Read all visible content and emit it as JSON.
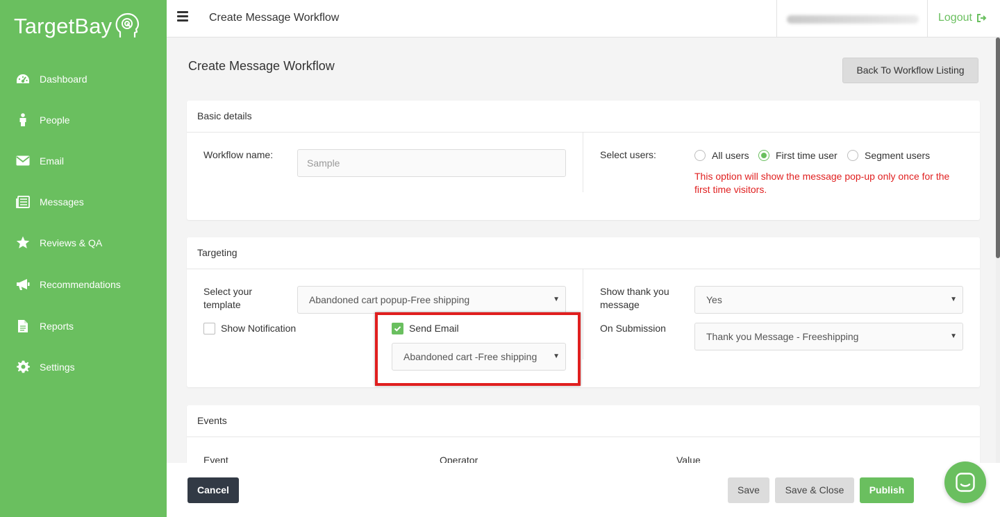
{
  "brand": {
    "name": "TargetBay"
  },
  "colors": {
    "primary": "#6abf5f",
    "warning_text": "#e01f1f",
    "dark": "#323a45"
  },
  "sidebar": {
    "items": [
      {
        "label": "Dashboard",
        "icon": "dashboard-icon"
      },
      {
        "label": "People",
        "icon": "person-icon"
      },
      {
        "label": "Email",
        "icon": "envelope-icon"
      },
      {
        "label": "Messages",
        "icon": "messages-icon"
      },
      {
        "label": "Reviews & QA",
        "icon": "star-icon"
      },
      {
        "label": "Recommendations",
        "icon": "megaphone-icon"
      },
      {
        "label": "Reports",
        "icon": "document-icon"
      },
      {
        "label": "Settings",
        "icon": "gear-icon"
      }
    ]
  },
  "topbar": {
    "title": "Create Message Workflow",
    "logout_label": "Logout"
  },
  "page": {
    "title": "Create Message Workflow",
    "back_button": "Back To Workflow Listing"
  },
  "basic_details": {
    "heading": "Basic details",
    "workflow_name_label": "Workflow name:",
    "workflow_name_placeholder": "Sample",
    "select_users_label": "Select users:",
    "radio_options": [
      {
        "label": "All users",
        "selected": false
      },
      {
        "label": "First time user",
        "selected": true
      },
      {
        "label": "Segment users",
        "selected": false
      }
    ],
    "notice": "This option will show the message pop-up only once for the first time visitors."
  },
  "targeting": {
    "heading": "Targeting",
    "template_label": "Select your template",
    "template_value": "Abandoned cart popup-Free shipping",
    "show_notification_label": "Show Notification",
    "show_notification_checked": false,
    "send_email_label": "Send Email",
    "send_email_checked": true,
    "email_template_value": "Abandoned cart -Free shipping",
    "thank_you_label": "Show thank you message",
    "thank_you_value": "Yes",
    "on_submission_label": "On Submission",
    "on_submission_value": "Thank you Message - Freeshipping"
  },
  "events": {
    "heading": "Events",
    "columns": [
      "Event",
      "Operator",
      "Value"
    ]
  },
  "footer": {
    "cancel": "Cancel",
    "save": "Save",
    "save_close": "Save & Close",
    "publish": "Publish"
  }
}
